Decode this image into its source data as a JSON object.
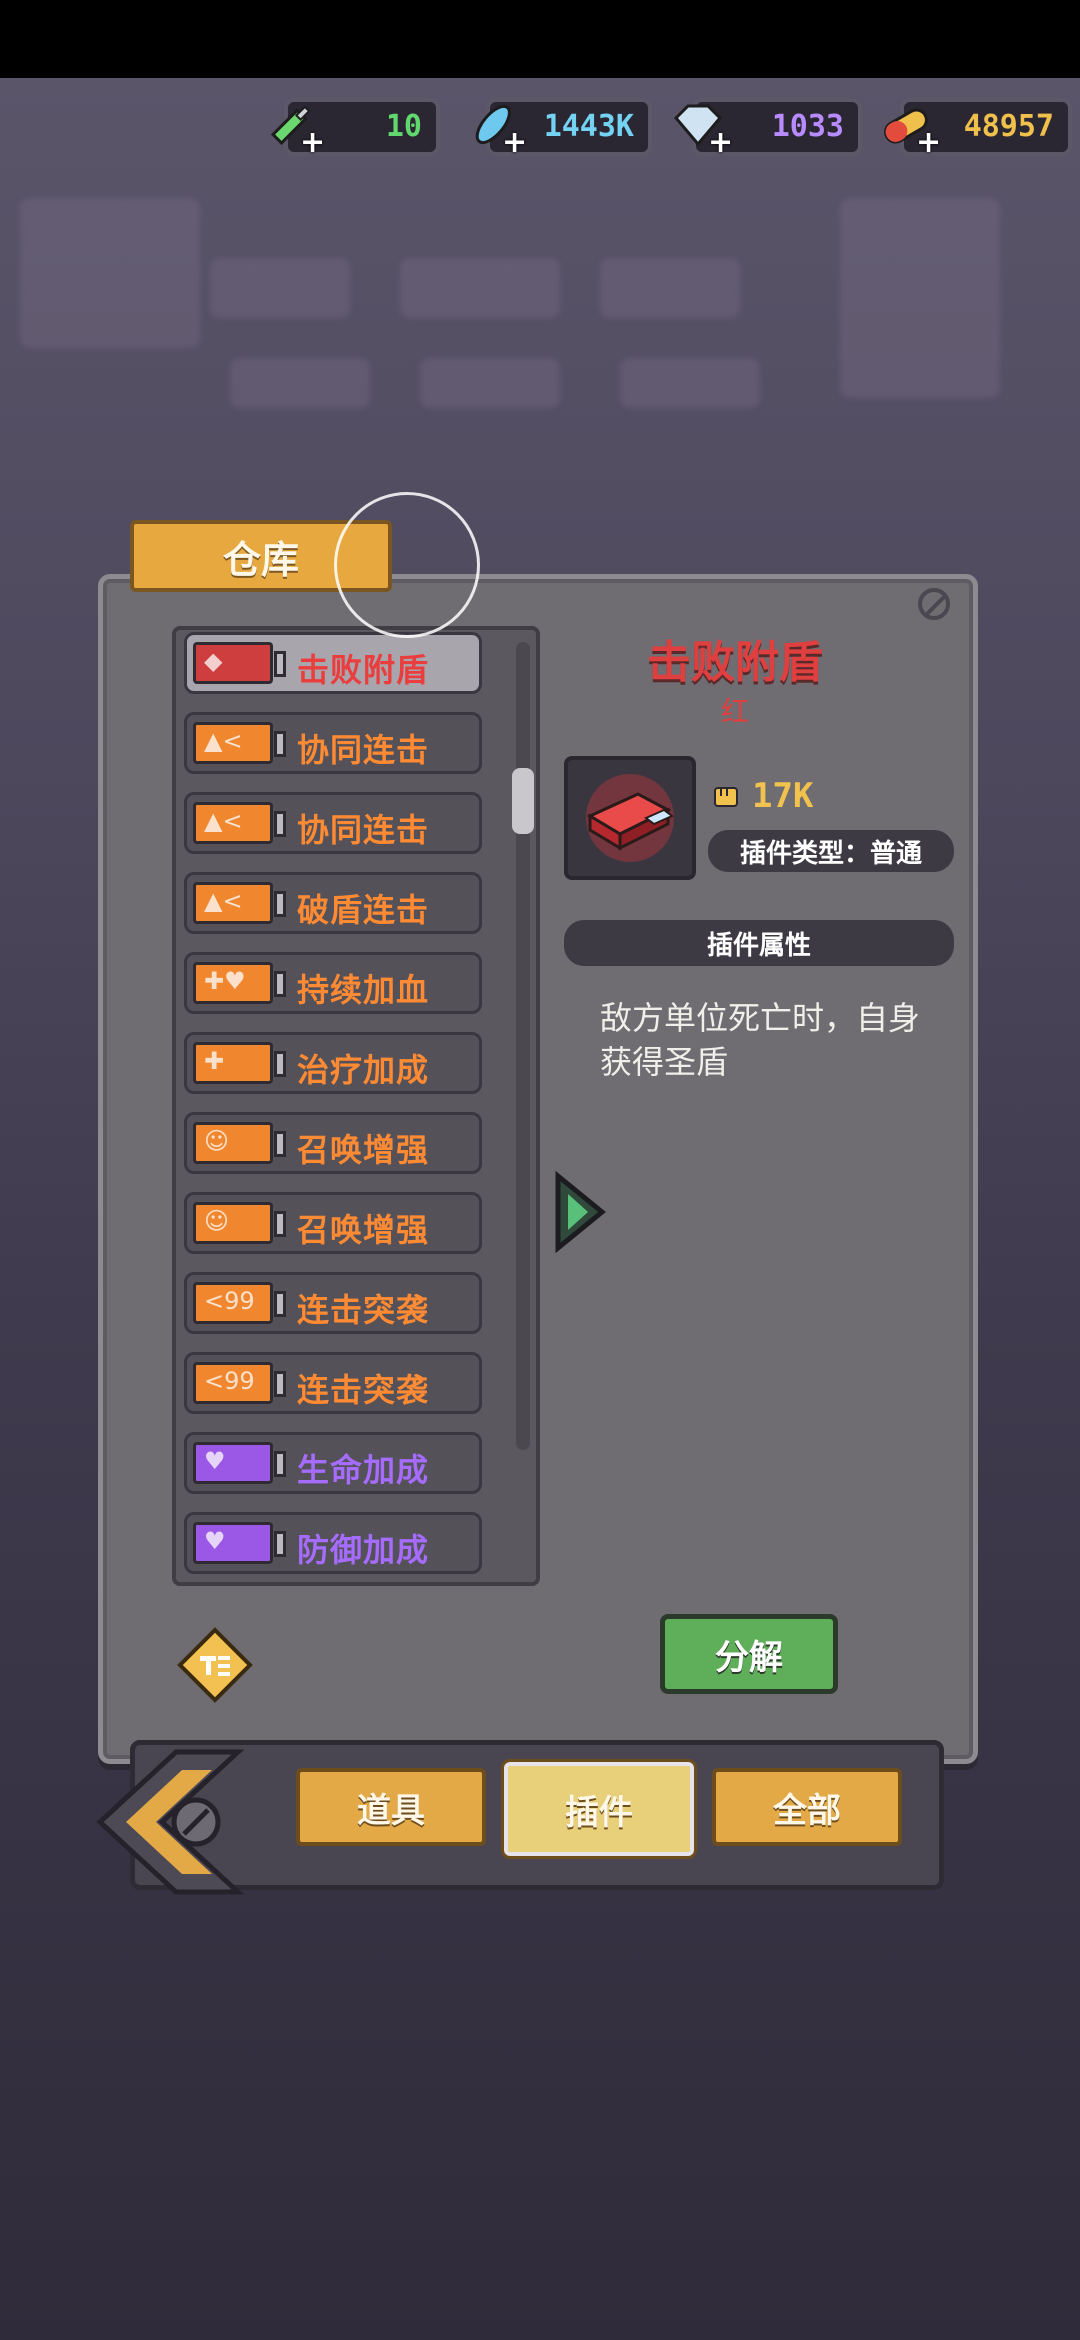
{
  "currencies": [
    {
      "icon": "syringe-icon",
      "value": "10",
      "color": "#61d86d"
    },
    {
      "icon": "feather-icon",
      "value": "1443K",
      "color": "#74d2f2"
    },
    {
      "icon": "diamond-icon",
      "value": "1033",
      "color": "#b88cff"
    },
    {
      "icon": "pill-icon",
      "value": "48957",
      "color": "#f0c04c"
    }
  ],
  "warehouse_tab": "仓库",
  "items": [
    {
      "name": "击败附盾",
      "color": "red",
      "selected": true
    },
    {
      "name": "协同连击",
      "color": "orange"
    },
    {
      "name": "协同连击",
      "color": "orange"
    },
    {
      "name": "破盾连击",
      "color": "orange"
    },
    {
      "name": "持续加血",
      "color": "orange"
    },
    {
      "name": "治疗加成",
      "color": "orange"
    },
    {
      "name": "召唤增强",
      "color": "orange"
    },
    {
      "name": "召唤增强",
      "color": "orange"
    },
    {
      "name": "连击突袭",
      "color": "orange"
    },
    {
      "name": "连击突袭",
      "color": "orange"
    },
    {
      "name": "生命加成",
      "color": "purple"
    },
    {
      "name": "防御加成",
      "color": "purple"
    }
  ],
  "detail": {
    "title": "击败附盾",
    "rarity": "红",
    "power": "17K",
    "type_label": "插件类型：普通",
    "attr_header": "插件属性",
    "description": "敌方单位死亡时，自身获得圣盾"
  },
  "decompose_label": "分解",
  "bottom_tabs": [
    {
      "label": "道具",
      "active": false
    },
    {
      "label": "插件",
      "active": true
    },
    {
      "label": "全部",
      "active": false
    }
  ]
}
